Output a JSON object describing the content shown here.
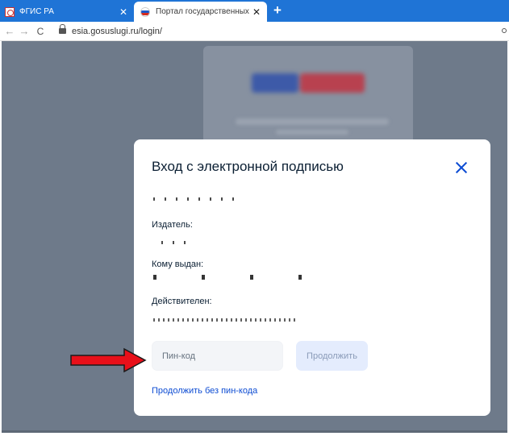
{
  "browser": {
    "tabs": [
      {
        "title": "ФГИС РА",
        "active": false
      },
      {
        "title": "Портал государственных услуг Р",
        "active": true
      }
    ],
    "new_tab_label": "+",
    "close_glyph": "✕",
    "nav": {
      "back": "←",
      "forward": "→",
      "reload": "C"
    },
    "url": "esia.gosuslugi.ru/login/"
  },
  "modal": {
    "title": "Вход с электронной подписью",
    "issuer_label": "Издатель:",
    "owner_label": "Кому выдан:",
    "valid_label": "Действителен:",
    "pin_placeholder": "Пин-код",
    "continue_label": "Продолжить",
    "no_pin_link": "Продолжить без пин-кода"
  },
  "colors": {
    "tabbar": "#1f74d6",
    "overlay": "#6e7a8a",
    "accent_link": "#0d4cd3",
    "disabled_button": "#e4ecfd",
    "annotation_arrow": "#e8101a"
  },
  "icons": [
    "fgis-favicon",
    "russian-flag-favicon",
    "close-icon",
    "lock-icon",
    "back-icon",
    "forward-icon",
    "reload-icon",
    "red-arrow-icon"
  ]
}
